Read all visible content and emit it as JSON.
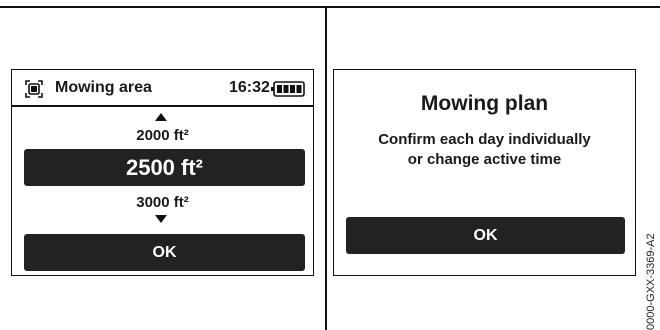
{
  "left_screen": {
    "title": "Mowing area",
    "time": "16:32",
    "icons": {
      "area": "mowing-area-icon",
      "battery": "battery-full-icon",
      "up": "arrow-up-icon",
      "down": "arrow-down-icon"
    },
    "values": {
      "previous": "2000 ft²",
      "selected": "2500 ft²",
      "next": "3000 ft²"
    },
    "ok_label": "OK"
  },
  "right_screen": {
    "title": "Mowing plan",
    "message_line1": "Confirm each day individually",
    "message_line2": "or change active time",
    "ok_label": "OK"
  },
  "document_code": "0000-GXX-3369-A2",
  "colors": {
    "button_bg": "#222222",
    "button_text": "#ffffff",
    "border": "#111111"
  }
}
